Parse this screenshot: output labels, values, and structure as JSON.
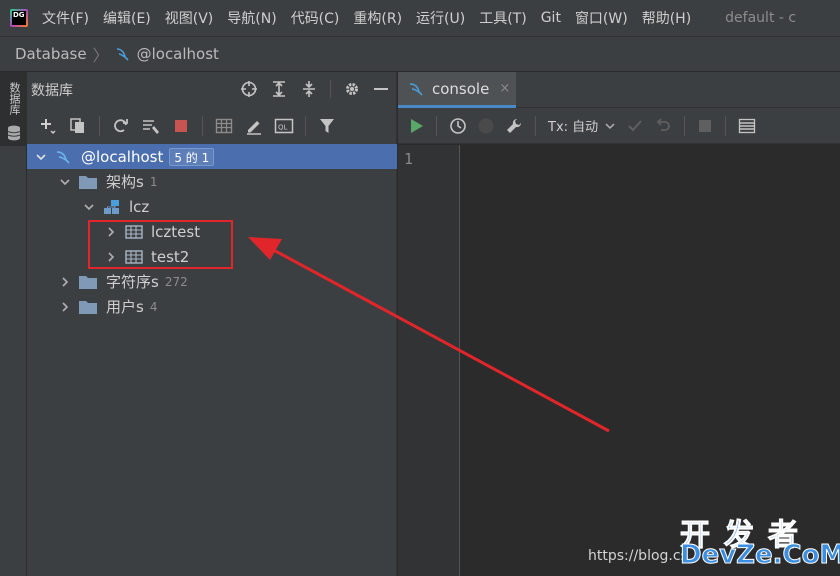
{
  "menubar": {
    "logo_text": "DG",
    "items": [
      "文件(F)",
      "编辑(E)",
      "视图(V)",
      "导航(N)",
      "代码(C)",
      "重构(R)",
      "运行(U)",
      "工具(T)",
      "Git",
      "窗口(W)",
      "帮助(H)"
    ],
    "window_title": "default - c"
  },
  "breadcrumb": {
    "root": "Database",
    "separator": "〉",
    "current": "@localhost"
  },
  "left_stripe": {
    "tab_label": "数据库"
  },
  "db_panel": {
    "title": "数据库",
    "tree": {
      "host": {
        "label": "@localhost",
        "badge": "5 的 1"
      },
      "schemas": {
        "label": "架构s",
        "count": "1"
      },
      "schema_lcz": {
        "label": "lcz"
      },
      "table_lcztest": {
        "label": "lcztest"
      },
      "table_test2": {
        "label": "test2"
      },
      "collations": {
        "label": "字符序s",
        "count": "272"
      },
      "users": {
        "label": "用户s",
        "count": "4"
      }
    }
  },
  "editor": {
    "tab_label": "console",
    "tab_close": "×",
    "tx_label": "Tx: 自动",
    "line_number": "1"
  },
  "watermark": {
    "url": "https://blog.cs",
    "cn": "开发者",
    "en": "DevZe.CoM"
  },
  "colors": {
    "accent_blue": "#4b6eaf",
    "run_green": "#59a869",
    "stop_red": "#c75450",
    "highlight_red": "#e0262b",
    "mysql_blue": "#4a9fdb"
  }
}
